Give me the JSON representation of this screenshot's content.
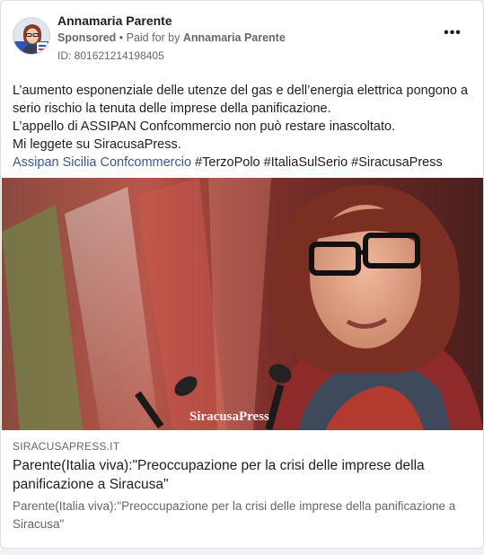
{
  "post": {
    "page_name": "Annamaria Parente",
    "sponsored": "Sponsored",
    "paid_for_prefix": " • Paid for by ",
    "paid_for_name": "Annamaria Parente",
    "ad_id": "ID: 801621214198405",
    "more_icon": "more-horizontal-icon",
    "more_label": "•••"
  },
  "body": {
    "line1": "L’aumento esponenziale delle utenze del gas e dell’energia elettrica pongono a serio rischio la tenuta delle imprese della panificazione.",
    "line2": "L’appello di ASSIPAN Confcommercio non può restare inascoltato.",
    "line3": "Mi leggete su SiracusaPress.",
    "tag_mention": "Assipan Sicilia Confcommercio",
    "hashtags": " #TerzoPolo #ItaliaSulSerio #SiracusaPress"
  },
  "media": {
    "watermark": "SiracusaPress"
  },
  "link": {
    "domain": "SIRACUSAPRESS.IT",
    "title": "Parente(Italia viva):\"Preoccupazione per la crisi delle imprese della panificazione a Siracusa\"",
    "description": "Parente(Italia viva):\"Preoccupazione per la crisi delle imprese della panificazione a Siracusa\""
  },
  "colors": {
    "link_blue": "#385898",
    "secondary_text": "#65676b"
  }
}
